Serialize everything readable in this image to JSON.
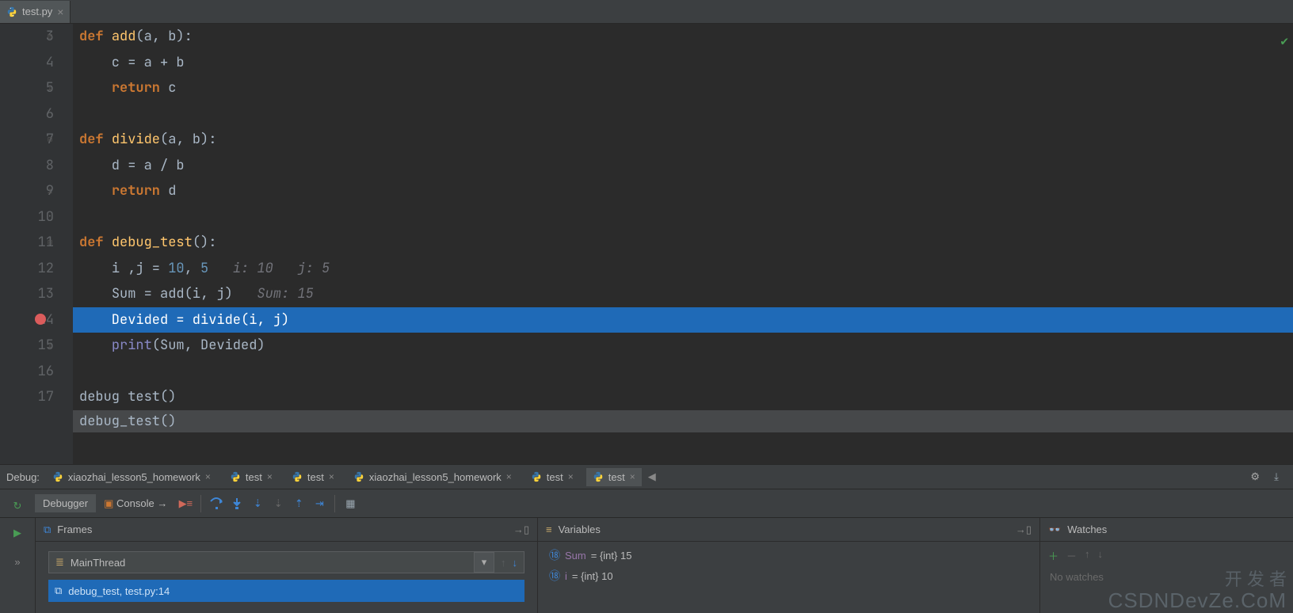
{
  "file_tab": {
    "label": "test.py"
  },
  "gutter_lines": [
    "3",
    "4",
    "5",
    "6",
    "7",
    "8",
    "9",
    "10",
    "11",
    "12",
    "13",
    "14",
    "15",
    "16",
    "17"
  ],
  "breakpoint_line": "14",
  "code": {
    "l3": {
      "kw": "def ",
      "fn": "add",
      "params": "(a, b)",
      "end": ":"
    },
    "l4": "    c = a + b",
    "l5": {
      "indent": "    ",
      "kw": "return ",
      "rest": "c"
    },
    "l6": "",
    "l7": {
      "kw": "def ",
      "fn": "divide",
      "params": "(a, b)",
      "end": ":"
    },
    "l8": "    d = a / b",
    "l9": {
      "indent": "    ",
      "kw": "return ",
      "rest": "d"
    },
    "l10": "",
    "l11": {
      "kw": "def ",
      "fn": "debug_test",
      "params": "()",
      "end": ":"
    },
    "l12": {
      "indent": "    ",
      "txt": "i ,j = ",
      "n1": "10",
      "mid": ", ",
      "n2": "5",
      "inlay": "   i: 10   j: 5"
    },
    "l13": {
      "indent": "    ",
      "txt": "Sum = add(i, j)",
      "inlay": "   Sum: 15"
    },
    "l14": "    Devided = divide(i, j)",
    "l15": {
      "indent": "    ",
      "fn": "print",
      "rest": "(Sum, Devided)"
    },
    "l16": "",
    "l17": "debug test()"
  },
  "completion_row": "debug_test()",
  "debug_label": "Debug:",
  "debug_tabs": [
    {
      "label": "xiaozhai_lesson5_homework",
      "sel": false
    },
    {
      "label": "test",
      "sel": false
    },
    {
      "label": "test",
      "sel": false
    },
    {
      "label": "xiaozhai_lesson5_homework",
      "sel": false
    },
    {
      "label": "test",
      "sel": false
    },
    {
      "label": "test",
      "sel": true
    }
  ],
  "toolbar": {
    "debugger": "Debugger",
    "console": "Console"
  },
  "frames": {
    "title": "Frames",
    "thread_icon": "thread-icon",
    "thread": "MainThread",
    "stack": "debug_test, test.py:14"
  },
  "variables": {
    "title": "Variables",
    "rows": [
      {
        "name": "Sum",
        "val": "= {int} 15"
      },
      {
        "name": "i",
        "val": "= {int} 10"
      }
    ]
  },
  "watches": {
    "title": "Watches",
    "empty": "No watches"
  },
  "watermark1": "开 发 者",
  "watermark2": "CSDNDevZe.CoM"
}
